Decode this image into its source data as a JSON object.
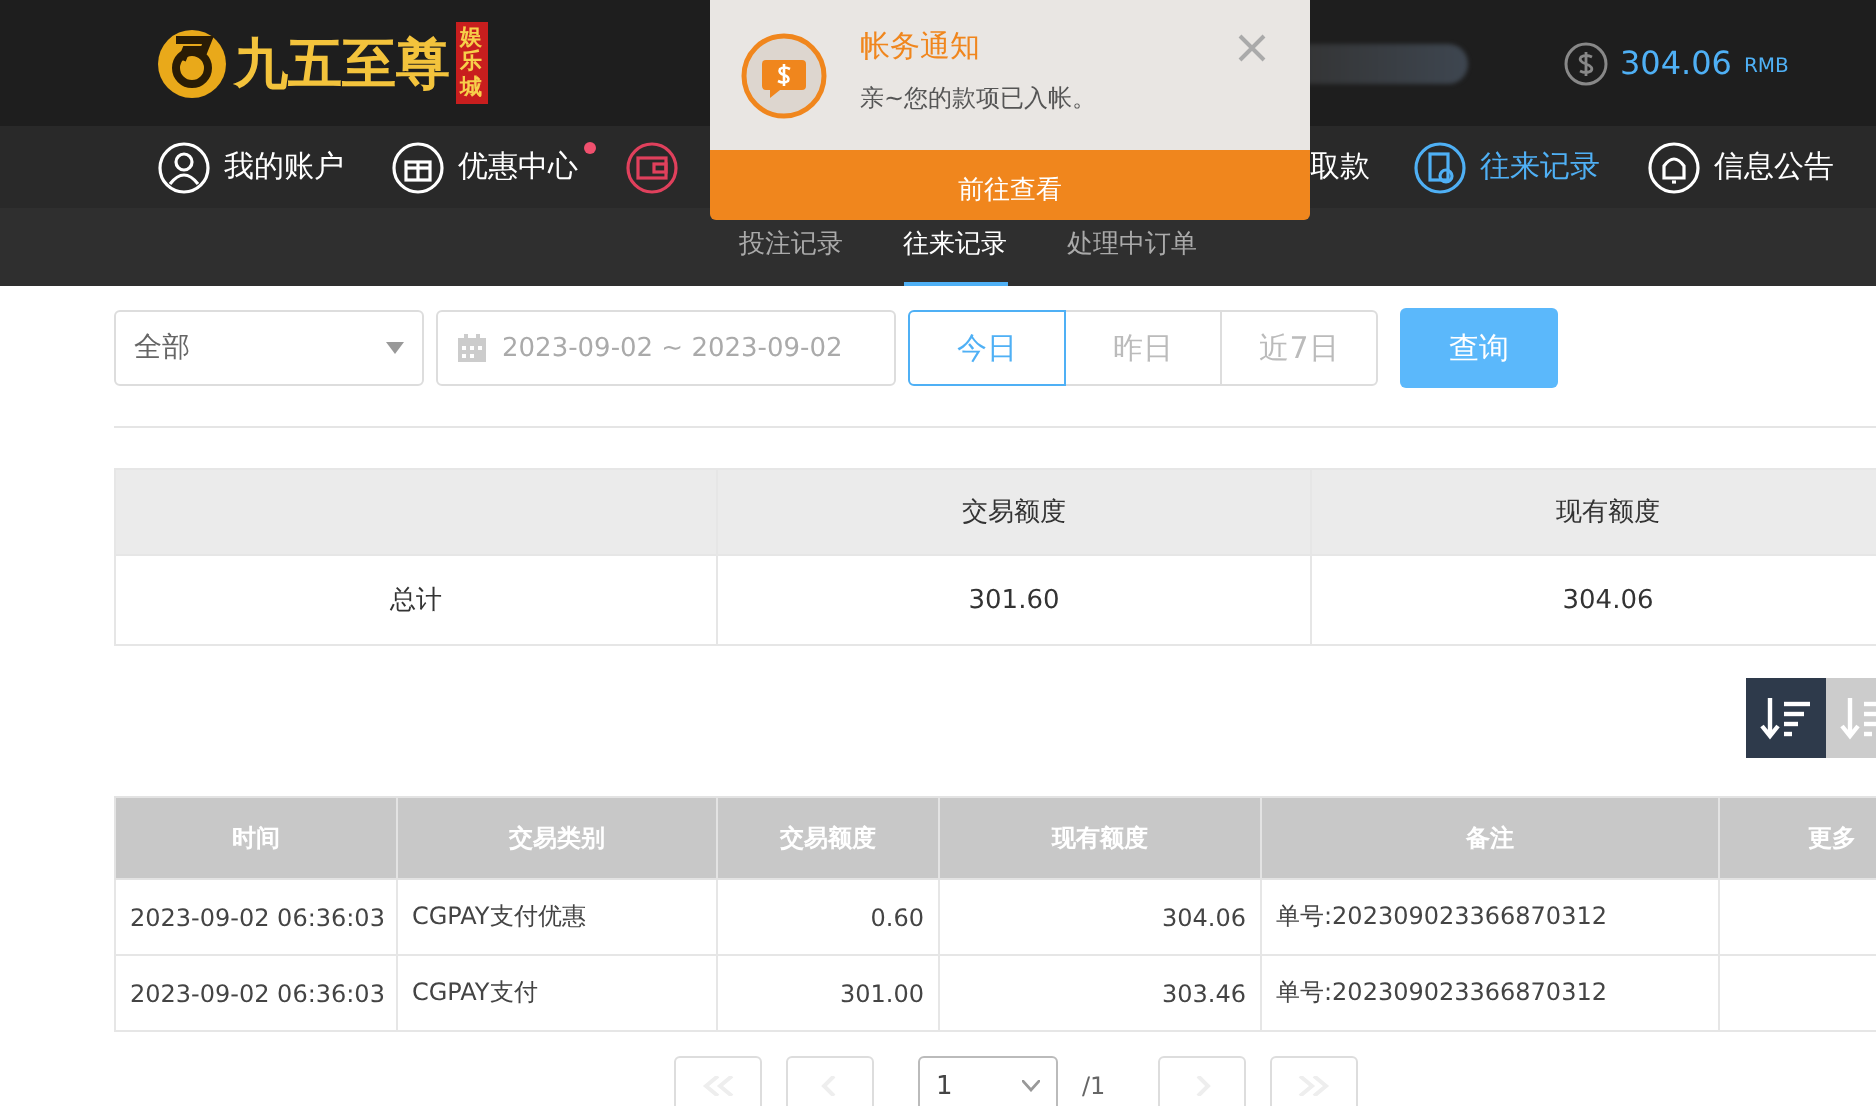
{
  "header": {
    "logo_text": "九五至尊",
    "logo_badge": "娱乐城",
    "balance": "304.06",
    "currency": "RMB"
  },
  "nav": [
    {
      "label": "我的账户",
      "selected": false,
      "dot": false
    },
    {
      "label": "优惠中心",
      "selected": false,
      "dot": true
    },
    {
      "label": "取款",
      "selected": false,
      "dot": false
    },
    {
      "label": "往来记录",
      "selected": true,
      "dot": false
    },
    {
      "label": "信息公告",
      "selected": false,
      "dot": false
    }
  ],
  "toast": {
    "title": "帐务通知",
    "message": "亲~您的款项已入帐。",
    "action": "前往查看"
  },
  "subtabs": [
    {
      "label": "投注记录",
      "selected": false
    },
    {
      "label": "往来记录",
      "selected": true
    },
    {
      "label": "处理中订单",
      "selected": false
    }
  ],
  "filters": {
    "type_select": "全部",
    "date_range": "2023-09-02 ~ 2023-09-02",
    "quick_ranges": [
      {
        "label": "今日",
        "selected": true
      },
      {
        "label": "昨日",
        "selected": false
      },
      {
        "label": "近7日",
        "selected": false
      }
    ],
    "query_button": "查询"
  },
  "summary": {
    "headers": [
      "交易额度",
      "现有额度"
    ],
    "row_label": "总计",
    "values": [
      "301.60",
      "304.06"
    ]
  },
  "sort_buttons": [
    {
      "selected": true
    },
    {
      "selected": false
    }
  ],
  "table": {
    "columns": [
      "时间",
      "交易类别",
      "交易额度",
      "现有额度",
      "备注",
      "更多"
    ],
    "rows": [
      [
        "2023-09-02 06:36:03",
        "CGPAY支付优惠",
        "0.60",
        "304.06",
        "单号:202309023366870312"
      ],
      [
        "2023-09-02 06:36:03",
        "CGPAY支付",
        "301.00",
        "303.46",
        "单号:202309023366870312"
      ]
    ]
  },
  "pagination": {
    "page": "1",
    "total": "/1"
  }
}
